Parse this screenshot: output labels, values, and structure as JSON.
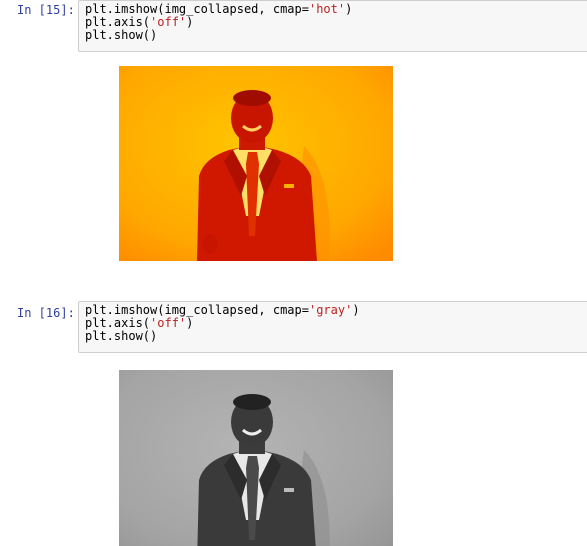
{
  "cells": [
    {
      "prompt": "In [15]:",
      "code_lines": [
        {
          "pre": "plt.imshow(img_collapsed, cmap=",
          "str": "'hot'",
          "post": ")"
        },
        {
          "pre": "plt.axis(",
          "str": "'off'",
          "post": ")"
        },
        {
          "pre": "plt.show()",
          "str": "",
          "post": ""
        }
      ],
      "output": {
        "type": "image",
        "colormap": "hot",
        "background_color": "#ffb000",
        "figure_color": "#cc1500"
      }
    },
    {
      "prompt": "In [16]:",
      "code_lines": [
        {
          "pre": "plt.imshow(img_collapsed, cmap=",
          "str": "'gray'",
          "post": ")"
        },
        {
          "pre": "plt.axis(",
          "str": "'off'",
          "post": ")"
        },
        {
          "pre": "plt.show()",
          "str": "",
          "post": ""
        }
      ],
      "output": {
        "type": "image",
        "colormap": "gray",
        "background_color": "#a9a9a9",
        "figure_color": "#333333"
      }
    }
  ],
  "colors": {
    "prompt": "#303f9f",
    "string": "#ba2121",
    "input_bg": "#f7f7f7",
    "input_border": "#cfcfcf"
  }
}
